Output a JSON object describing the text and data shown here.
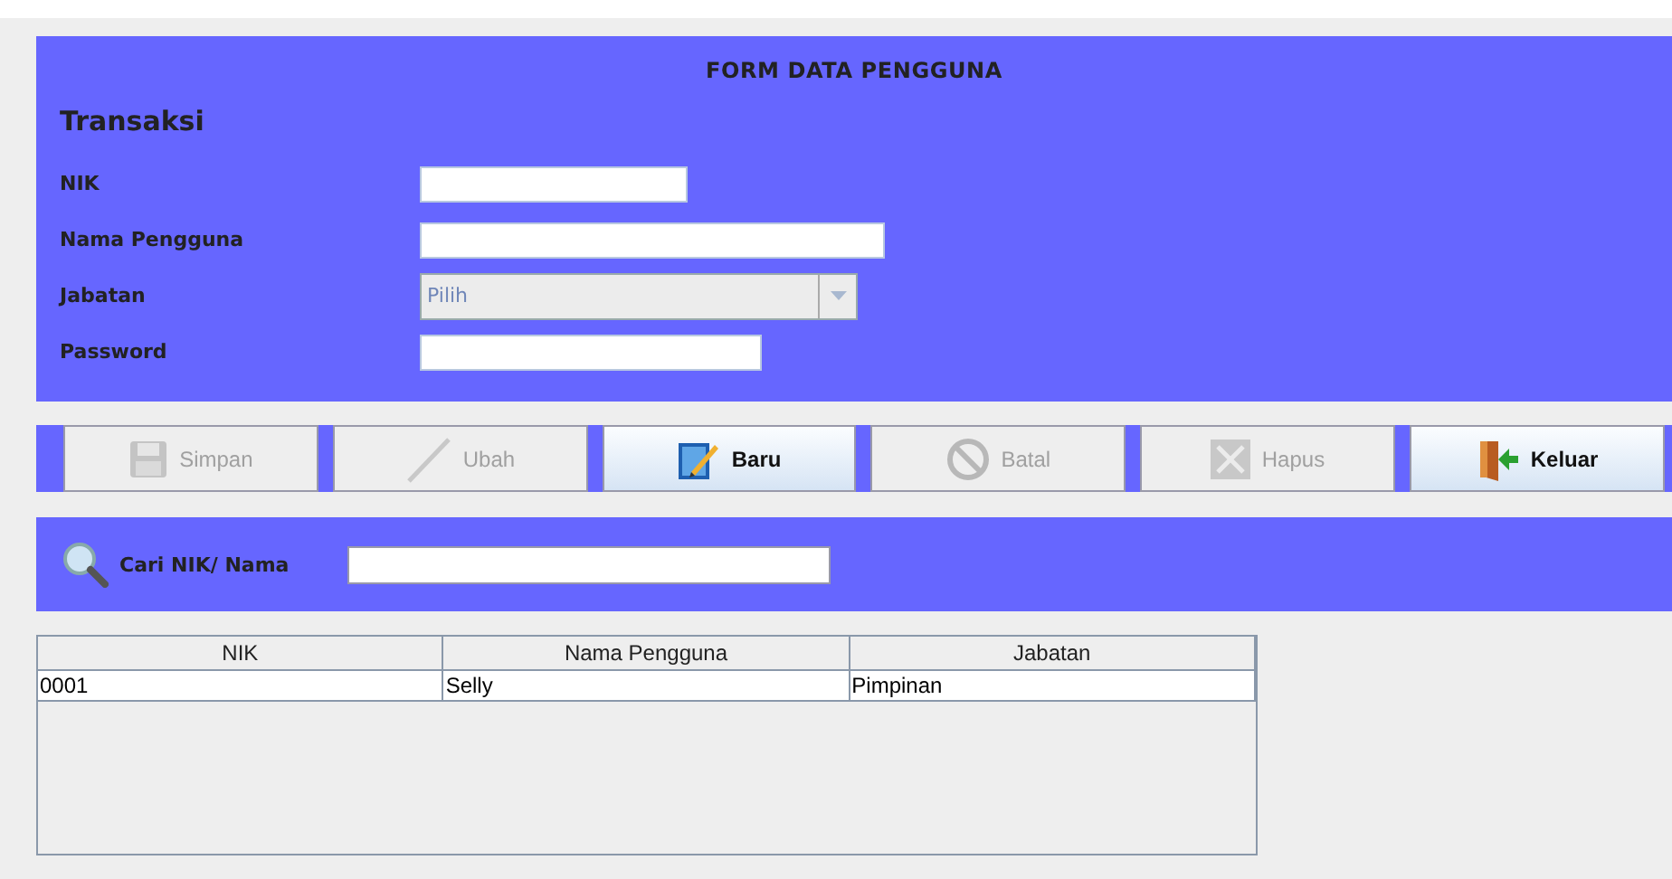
{
  "form": {
    "title": "FORM DATA PENGGUNA",
    "section": "Transaksi",
    "fields": [
      {
        "label": "NIK",
        "kind": "text"
      },
      {
        "label": "Nama Pengguna",
        "kind": "text"
      },
      {
        "label": "Jabatan",
        "kind": "select",
        "placeholder": "Pilih",
        "disabled": true
      },
      {
        "label": "Password",
        "kind": "text"
      }
    ]
  },
  "toolbar": [
    {
      "label": "Simpan",
      "disabled": true
    },
    {
      "label": "Ubah",
      "disabled": true
    },
    {
      "label": "Baru",
      "disabled": false
    },
    {
      "label": "Batal",
      "disabled": true
    },
    {
      "label": "Hapus",
      "disabled": true
    },
    {
      "label": "Keluar",
      "disabled": false
    }
  ],
  "search": {
    "label": "Cari NIK/ Nama"
  },
  "table": {
    "columns": [
      "NIK",
      "Nama Pengguna",
      "Jabatan"
    ],
    "rows": [
      [
        "0001",
        "Selly",
        "Pimpinan"
      ]
    ]
  }
}
